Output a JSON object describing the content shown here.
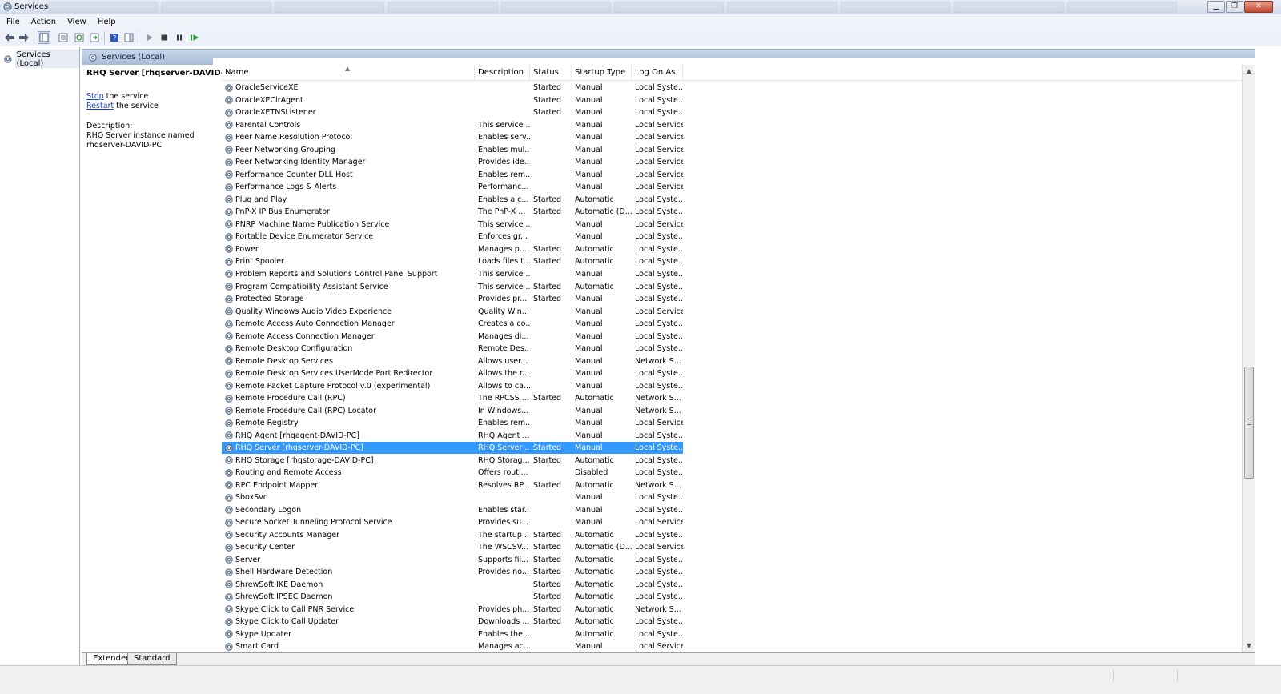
{
  "window": {
    "title": "Services"
  },
  "menu": [
    "File",
    "Action",
    "View",
    "Help"
  ],
  "tree": {
    "root_label": "Services (Local)"
  },
  "pane": {
    "header": "Services (Local)"
  },
  "extended": {
    "selected_title": "RHQ Server [rhqserver-DAVID-PC]",
    "stop_link": "Stop",
    "stop_suffix": " the service",
    "restart_link": "Restart",
    "restart_suffix": " the service",
    "description_label": "Description:",
    "description_line1": "RHQ Server instance named",
    "description_line2": "rhqserver-DAVID-PC"
  },
  "columns": [
    "Name",
    "Description",
    "Status",
    "Startup Type",
    "Log On As"
  ],
  "services": [
    {
      "name": "OracleServiceXE",
      "desc": "",
      "status": "Started",
      "startup": "Manual",
      "logon": "Local Syste..."
    },
    {
      "name": "OracleXEClrAgent",
      "desc": "",
      "status": "Started",
      "startup": "Manual",
      "logon": "Local Syste..."
    },
    {
      "name": "OracleXETNSListener",
      "desc": "",
      "status": "Started",
      "startup": "Manual",
      "logon": "Local Syste..."
    },
    {
      "name": "Parental Controls",
      "desc": "This service ...",
      "status": "",
      "startup": "Manual",
      "logon": "Local Service"
    },
    {
      "name": "Peer Name Resolution Protocol",
      "desc": "Enables serv...",
      "status": "",
      "startup": "Manual",
      "logon": "Local Service"
    },
    {
      "name": "Peer Networking Grouping",
      "desc": "Enables mul...",
      "status": "",
      "startup": "Manual",
      "logon": "Local Service"
    },
    {
      "name": "Peer Networking Identity Manager",
      "desc": "Provides ide...",
      "status": "",
      "startup": "Manual",
      "logon": "Local Service"
    },
    {
      "name": "Performance Counter DLL Host",
      "desc": "Enables rem...",
      "status": "",
      "startup": "Manual",
      "logon": "Local Service"
    },
    {
      "name": "Performance Logs & Alerts",
      "desc": "Performanc...",
      "status": "",
      "startup": "Manual",
      "logon": "Local Service"
    },
    {
      "name": "Plug and Play",
      "desc": "Enables a c...",
      "status": "Started",
      "startup": "Automatic",
      "logon": "Local Syste..."
    },
    {
      "name": "PnP-X IP Bus Enumerator",
      "desc": "The PnP-X ...",
      "status": "Started",
      "startup": "Automatic (D...",
      "logon": "Local Syste..."
    },
    {
      "name": "PNRP Machine Name Publication Service",
      "desc": "This service ...",
      "status": "",
      "startup": "Manual",
      "logon": "Local Service"
    },
    {
      "name": "Portable Device Enumerator Service",
      "desc": "Enforces gr...",
      "status": "",
      "startup": "Manual",
      "logon": "Local Syste..."
    },
    {
      "name": "Power",
      "desc": "Manages p...",
      "status": "Started",
      "startup": "Automatic",
      "logon": "Local Syste..."
    },
    {
      "name": "Print Spooler",
      "desc": "Loads files t...",
      "status": "Started",
      "startup": "Automatic",
      "logon": "Local Syste..."
    },
    {
      "name": "Problem Reports and Solutions Control Panel Support",
      "desc": "This service ...",
      "status": "",
      "startup": "Manual",
      "logon": "Local Syste..."
    },
    {
      "name": "Program Compatibility Assistant Service",
      "desc": "This service ...",
      "status": "Started",
      "startup": "Automatic",
      "logon": "Local Syste..."
    },
    {
      "name": "Protected Storage",
      "desc": "Provides pr...",
      "status": "Started",
      "startup": "Manual",
      "logon": "Local Syste..."
    },
    {
      "name": "Quality Windows Audio Video Experience",
      "desc": "Quality Win...",
      "status": "",
      "startup": "Manual",
      "logon": "Local Service"
    },
    {
      "name": "Remote Access Auto Connection Manager",
      "desc": "Creates a co...",
      "status": "",
      "startup": "Manual",
      "logon": "Local Syste..."
    },
    {
      "name": "Remote Access Connection Manager",
      "desc": "Manages di...",
      "status": "",
      "startup": "Manual",
      "logon": "Local Syste..."
    },
    {
      "name": "Remote Desktop Configuration",
      "desc": "Remote Des...",
      "status": "",
      "startup": "Manual",
      "logon": "Local Syste..."
    },
    {
      "name": "Remote Desktop Services",
      "desc": "Allows user...",
      "status": "",
      "startup": "Manual",
      "logon": "Network S..."
    },
    {
      "name": "Remote Desktop Services UserMode Port Redirector",
      "desc": "Allows the r...",
      "status": "",
      "startup": "Manual",
      "logon": "Local Syste..."
    },
    {
      "name": "Remote Packet Capture Protocol v.0 (experimental)",
      "desc": "Allows to ca...",
      "status": "",
      "startup": "Manual",
      "logon": "Local Syste..."
    },
    {
      "name": "Remote Procedure Call (RPC)",
      "desc": "The RPCSS ...",
      "status": "Started",
      "startup": "Automatic",
      "logon": "Network S..."
    },
    {
      "name": "Remote Procedure Call (RPC) Locator",
      "desc": "In Windows...",
      "status": "",
      "startup": "Manual",
      "logon": "Network S..."
    },
    {
      "name": "Remote Registry",
      "desc": "Enables rem...",
      "status": "",
      "startup": "Manual",
      "logon": "Local Service"
    },
    {
      "name": "RHQ Agent [rhqagent-DAVID-PC]",
      "desc": "RHQ Agent ...",
      "status": "",
      "startup": "Manual",
      "logon": "Local Syste..."
    },
    {
      "name": "RHQ Server [rhqserver-DAVID-PC]",
      "desc": "RHQ Server ...",
      "status": "Started",
      "startup": "Manual",
      "logon": "Local Syste...",
      "selected": true
    },
    {
      "name": "RHQ Storage [rhqstorage-DAVID-PC]",
      "desc": "RHQ Storag...",
      "status": "Started",
      "startup": "Automatic",
      "logon": "Local Syste..."
    },
    {
      "name": "Routing and Remote Access",
      "desc": "Offers routi...",
      "status": "",
      "startup": "Disabled",
      "logon": "Local Syste..."
    },
    {
      "name": "RPC Endpoint Mapper",
      "desc": "Resolves RP...",
      "status": "Started",
      "startup": "Automatic",
      "logon": "Network S..."
    },
    {
      "name": "SboxSvc",
      "desc": "",
      "status": "",
      "startup": "Manual",
      "logon": "Local Syste..."
    },
    {
      "name": "Secondary Logon",
      "desc": "Enables star...",
      "status": "",
      "startup": "Manual",
      "logon": "Local Syste..."
    },
    {
      "name": "Secure Socket Tunneling Protocol Service",
      "desc": "Provides su...",
      "status": "",
      "startup": "Manual",
      "logon": "Local Service"
    },
    {
      "name": "Security Accounts Manager",
      "desc": "The startup ...",
      "status": "Started",
      "startup": "Automatic",
      "logon": "Local Syste..."
    },
    {
      "name": "Security Center",
      "desc": "The WSCSV...",
      "status": "Started",
      "startup": "Automatic (D...",
      "logon": "Local Service"
    },
    {
      "name": "Server",
      "desc": "Supports fil...",
      "status": "Started",
      "startup": "Automatic",
      "logon": "Local Syste..."
    },
    {
      "name": "Shell Hardware Detection",
      "desc": "Provides no...",
      "status": "Started",
      "startup": "Automatic",
      "logon": "Local Syste..."
    },
    {
      "name": "ShrewSoft IKE Daemon",
      "desc": "",
      "status": "Started",
      "startup": "Automatic",
      "logon": "Local Syste..."
    },
    {
      "name": "ShrewSoft IPSEC Daemon",
      "desc": "",
      "status": "Started",
      "startup": "Automatic",
      "logon": "Local Syste..."
    },
    {
      "name": "Skype Click to Call PNR Service",
      "desc": "Provides ph...",
      "status": "Started",
      "startup": "Automatic",
      "logon": "Network S..."
    },
    {
      "name": "Skype Click to Call Updater",
      "desc": "Downloads ...",
      "status": "Started",
      "startup": "Automatic",
      "logon": "Local Syste..."
    },
    {
      "name": "Skype Updater",
      "desc": "Enables the ...",
      "status": "",
      "startup": "Automatic",
      "logon": "Local Syste..."
    },
    {
      "name": "Smart Card",
      "desc": "Manages ac...",
      "status": "",
      "startup": "Manual",
      "logon": "Local Service"
    }
  ],
  "tabs": [
    "Extended",
    "Standard"
  ],
  "icons": {
    "service": "gear-icon",
    "back": "back-arrow-icon",
    "forward": "forward-arrow-icon",
    "start": "play-icon",
    "stop": "stop-icon",
    "pause": "pause-icon",
    "restart": "restart-icon",
    "help": "help-icon"
  },
  "colors": {
    "selection": "#3399ff",
    "link": "#1545c6",
    "header": "#a7bcd9"
  }
}
